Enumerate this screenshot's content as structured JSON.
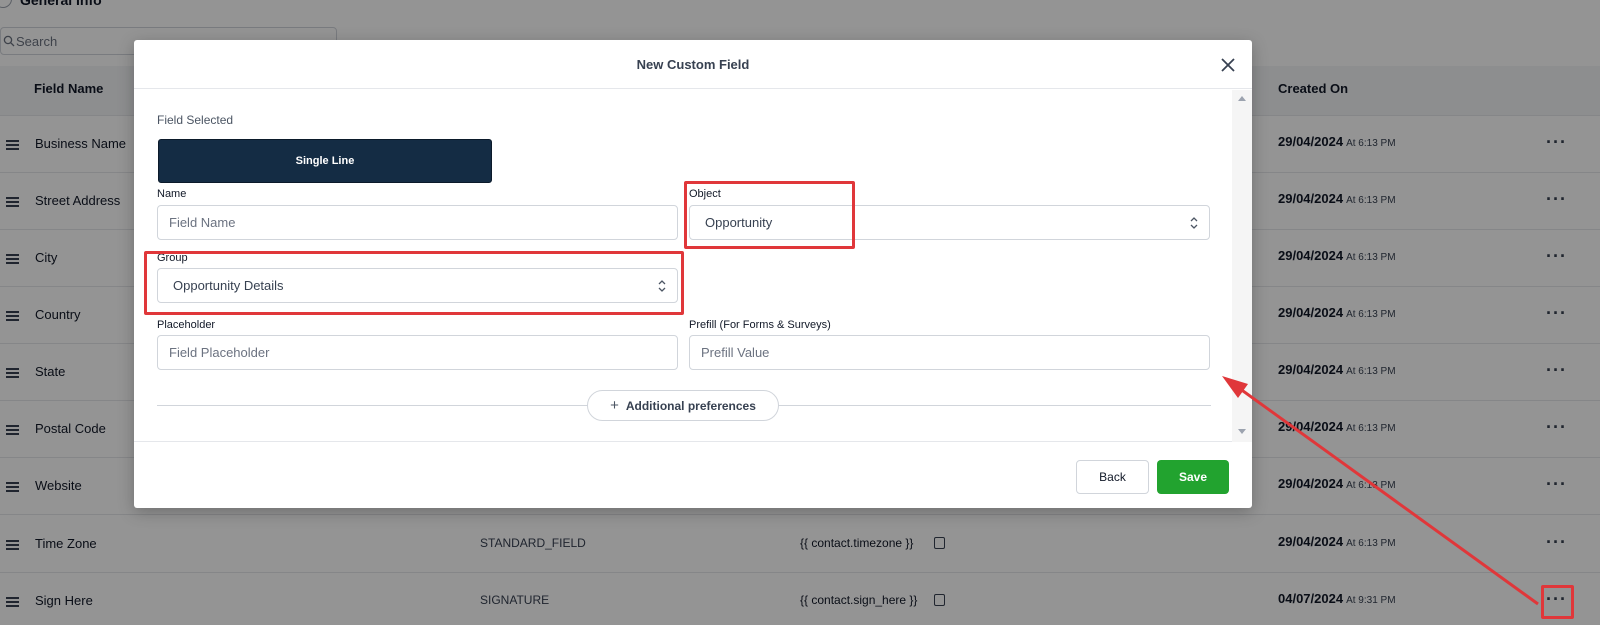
{
  "background": {
    "general_info": "General Info",
    "search_placeholder": "Search",
    "columns": {
      "field_name": "Field Name",
      "created_on": "Created On"
    },
    "rows": [
      {
        "name": "Business Name",
        "type": "",
        "key": "",
        "date": "29/04/2024",
        "time": "At 6:13 PM"
      },
      {
        "name": "Street Address",
        "type": "",
        "key": "",
        "date": "29/04/2024",
        "time": "At 6:13 PM"
      },
      {
        "name": "City",
        "type": "",
        "key": "",
        "date": "29/04/2024",
        "time": "At 6:13 PM"
      },
      {
        "name": "Country",
        "type": "",
        "key": "",
        "date": "29/04/2024",
        "time": "At 6:13 PM"
      },
      {
        "name": "State",
        "type": "",
        "key": "",
        "date": "29/04/2024",
        "time": "At 6:13 PM"
      },
      {
        "name": "Postal Code",
        "type": "",
        "key": "",
        "date": "29/04/2024",
        "time": "At 6:13 PM"
      },
      {
        "name": "Website",
        "type": "",
        "key": "",
        "date": "29/04/2024",
        "time": "At 6:13 PM"
      },
      {
        "name": "Time Zone",
        "type": "STANDARD_FIELD",
        "key": "{{ contact.timezone }}",
        "date": "29/04/2024",
        "time": "At 6:13 PM"
      },
      {
        "name": "Sign Here",
        "type": "SIGNATURE",
        "key": "{{ contact.sign_here }}",
        "date": "04/07/2024",
        "time": "At 9:31 PM"
      }
    ],
    "more_actions_label": "···"
  },
  "modal": {
    "title": "New Custom Field",
    "field_selected_label": "Field Selected",
    "field_type": "Single Line",
    "name_label": "Name",
    "name_placeholder": "Field Name",
    "object_label": "Object",
    "object_value": "Opportunity",
    "group_label": "Group",
    "group_value": "Opportunity Details",
    "placeholder_label": "Placeholder",
    "placeholder_placeholder": "Field Placeholder",
    "prefill_label": "Prefill (For Forms & Surveys)",
    "prefill_placeholder": "Prefill Value",
    "additional_preferences": "Additional preferences",
    "back_label": "Back",
    "save_label": "Save"
  },
  "colors": {
    "field_type_bg": "#142c44",
    "save_bg": "#22a32f",
    "highlight": "#e0373a"
  }
}
